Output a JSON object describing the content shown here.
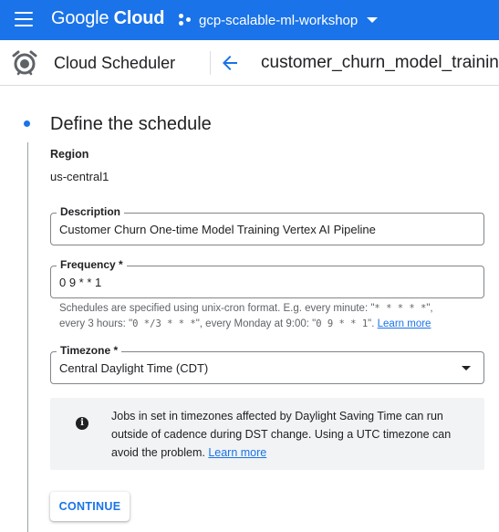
{
  "topbar": {
    "brand_google": "Google",
    "brand_cloud": "Cloud",
    "project_name": "gcp-scalable-ml-workshop"
  },
  "subbar": {
    "service_title": "Cloud Scheduler",
    "job_title": "customer_churn_model_training_"
  },
  "section": {
    "title": "Define the schedule"
  },
  "region": {
    "label": "Region",
    "value": "us-central1"
  },
  "description": {
    "label": "Description",
    "value": "Customer Churn One-time Model Training Vertex AI Pipeline"
  },
  "frequency": {
    "label": "Frequency *",
    "value": "0 9 * * 1",
    "hint_line1_pre": "Schedules are specified using unix-cron format. E.g. every minute: \"",
    "hint_ex_minute": "* * * * *",
    "hint_line1_post": "\",",
    "hint_line2_pre": "every 3 hours: \"",
    "hint_ex_3h": "0 */3 * * *",
    "hint_line2_mid": "\", every Monday at 9:00: \"",
    "hint_ex_monday": "0 9 * * 1",
    "hint_line2_post": "\".",
    "learn_more": "Learn more"
  },
  "timezone": {
    "label": "Timezone *",
    "value": "Central Daylight Time (CDT)"
  },
  "info": {
    "text": "Jobs in set in timezones affected by Daylight Saving Time can run outside of cadence during DST change. Using a UTC timezone can avoid the problem.",
    "learn_more": "Learn more"
  },
  "actions": {
    "continue_label": "CONTINUE"
  },
  "colors": {
    "primary": "#1a73e8",
    "info_bg": "#f1f3f4"
  }
}
